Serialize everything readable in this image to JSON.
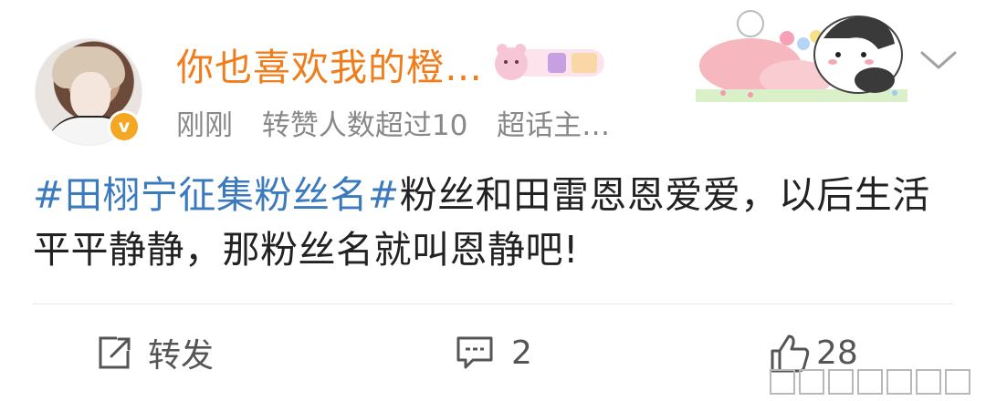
{
  "post": {
    "author": {
      "name": "你也喜欢我的橙…",
      "verified_badge": "v"
    },
    "meta": {
      "time": "刚刚",
      "repost_note": "转赞人数超过10",
      "source": "超话主…"
    },
    "content": {
      "topic": "#田栩宁征集粉丝名#",
      "text": "粉丝和田雷恩恩爱爱，以后生活平平静静，那粉丝名就叫恩静吧!"
    }
  },
  "actions": {
    "repost_label": "转发",
    "comment_count": "2",
    "like_count": "28"
  },
  "icons": {
    "more": "chevron-down-icon",
    "repost": "repost-icon",
    "comment": "comment-icon",
    "like": "thumbs-up-icon"
  },
  "colors": {
    "username": "#f07d1b",
    "topic": "#3b7bbd",
    "badge": "#f5a623",
    "meta": "#888888"
  }
}
